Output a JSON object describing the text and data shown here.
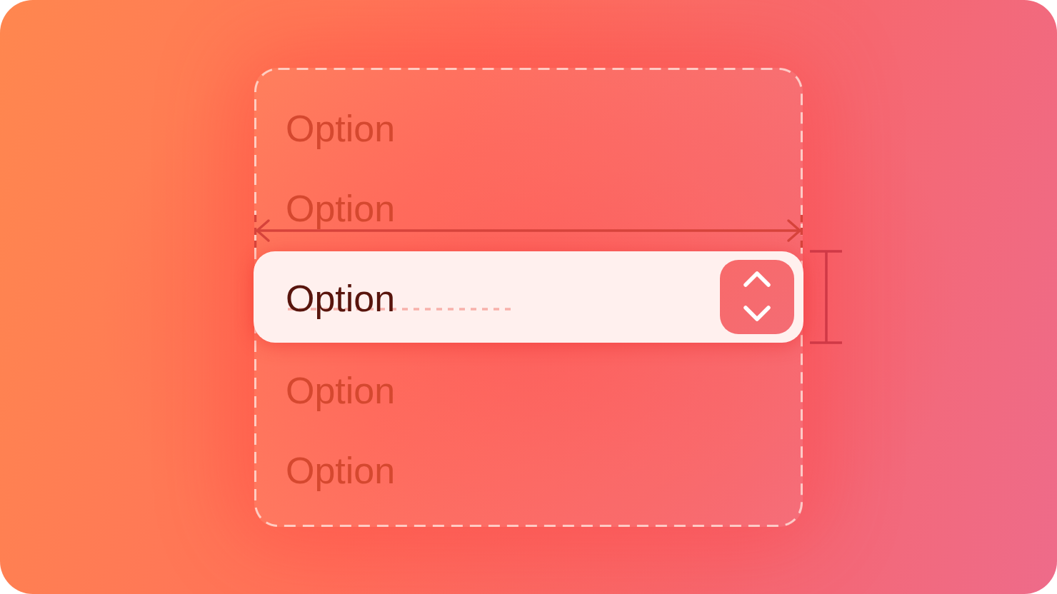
{
  "options": [
    {
      "label": "Option",
      "selected": false
    },
    {
      "label": "Option",
      "selected": false
    },
    {
      "label": "Option",
      "selected": true
    },
    {
      "label": "Option",
      "selected": false
    },
    {
      "label": "Option",
      "selected": false
    }
  ]
}
